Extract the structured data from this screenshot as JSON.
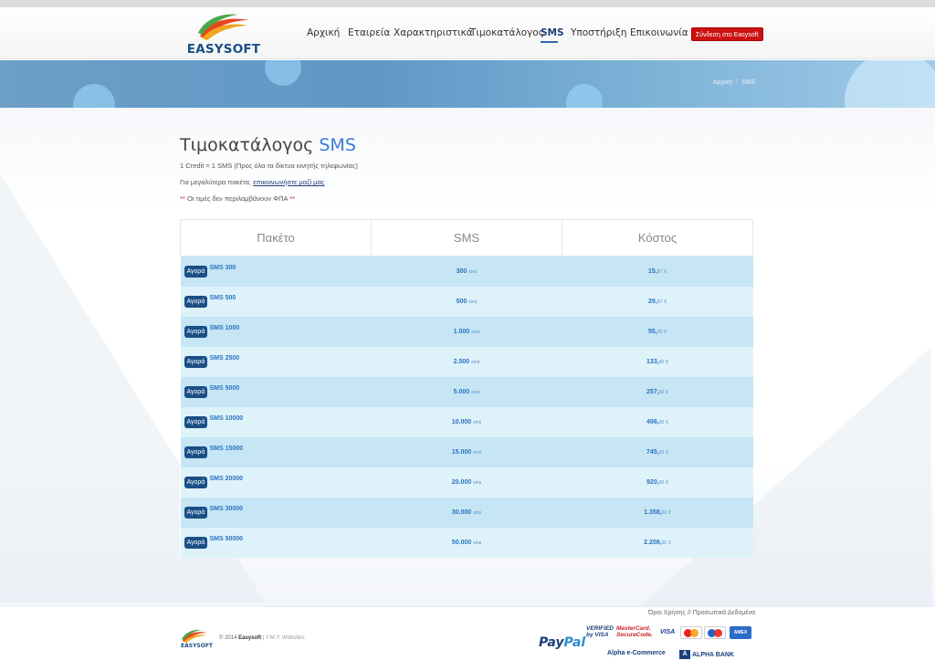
{
  "header": {
    "logo_text": "EASYSOFT",
    "nav": [
      {
        "label": "Αρχική",
        "active": false
      },
      {
        "label": "Εταιρεία",
        "active": false
      },
      {
        "label": "Χαρακτηριστικά",
        "active": false
      },
      {
        "label": "Τιμοκατάλογος",
        "active": false
      },
      {
        "label": "SMS",
        "active": true
      },
      {
        "label": "Υποστήριξη",
        "active": false
      },
      {
        "label": "Επικοινωνία",
        "active": false
      }
    ],
    "login_label": "Σύνδεση στο Easysoft"
  },
  "breadcrumb": {
    "home": "Αρχική",
    "separator": "/",
    "current": "SMS"
  },
  "page": {
    "title_main": "Τιμοκατάλογος",
    "title_accent": "SMS",
    "note1": "1 Credit = 1 SMS (Προς όλα τα δίκτυα κινητής τηλεφωνίας)",
    "note2_prefix": "Για μεγαλύτερα πακέτα,",
    "note2_link": "επικοινωνήστε μαζί μας",
    "note3_stars": "**",
    "note3_text": "Οι τιμές δεν περιλαμβάνουν ΦΠΑ"
  },
  "table": {
    "headers": [
      "Πακέτο",
      "SMS",
      "Κόστος"
    ],
    "buy_label": "Αγορά",
    "sms_unit": "sms",
    "currency": "€",
    "rows": [
      {
        "package": "SMS 300",
        "sms": "300",
        "cost_int": "15,",
        "cost_dec": "87"
      },
      {
        "package": "SMS 500",
        "sms": "500",
        "cost_int": "29,",
        "cost_dec": "67"
      },
      {
        "package": "SMS 1000",
        "sms": "1.000",
        "cost_int": "55,",
        "cost_dec": "00"
      },
      {
        "package": "SMS 2500",
        "sms": "2.500",
        "cost_int": "133,",
        "cost_dec": "40"
      },
      {
        "package": "SMS 5000",
        "sms": "5.000",
        "cost_int": "257,",
        "cost_dec": "60"
      },
      {
        "package": "SMS 10000",
        "sms": "10.000",
        "cost_int": "496,",
        "cost_dec": "00"
      },
      {
        "package": "SMS 15000",
        "sms": "15.000",
        "cost_int": "745,",
        "cost_dec": "30"
      },
      {
        "package": "SMS 20000",
        "sms": "20.000",
        "cost_int": "920,",
        "cost_dec": "00"
      },
      {
        "package": "SMS 30000",
        "sms": "30.000",
        "cost_int": "1.358,",
        "cost_dec": "50"
      },
      {
        "package": "SMS 50000",
        "sms": "50.000",
        "cost_int": "2.208,",
        "cost_dec": "00"
      }
    ]
  },
  "footer": {
    "links": "Όροι Χρήσης // Προσωπικά Δεδομένα",
    "logo_text": "EASYSOFT",
    "copyright_prefix": "© 2014",
    "copyright_brand": "Easysoft",
    "copyright_suffix": "| Y.M.Y. Websites",
    "paypal_1": "Pay",
    "paypal_2": "Pal",
    "verified_1": "VERIFIED",
    "verified_2": "by VISA",
    "mastercard_1": "MasterCard.",
    "mastercard_2": "SecureCode.",
    "card_visa": "VISA",
    "card_amex": "AMEX",
    "alpha_ecommerce": "Alpha e-Commerce",
    "alpha_bank_icon": "A",
    "alpha_bank": "ALPHA BANK"
  }
}
